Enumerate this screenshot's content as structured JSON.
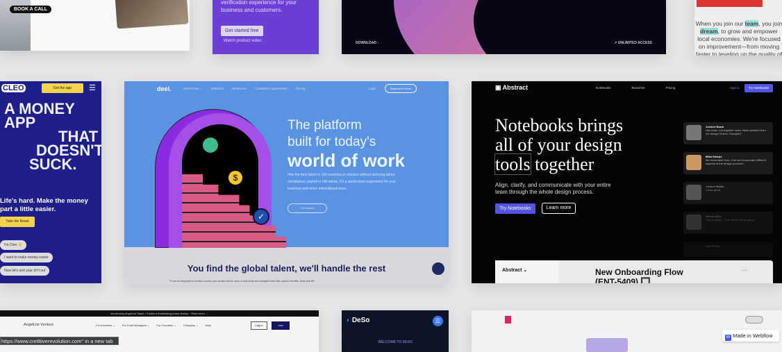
{
  "card1": {
    "book_call": "BOOK A CALL"
  },
  "card2": {
    "text": "verification experience for your business and customers.",
    "cta": "Get started free",
    "watch": "Watch product video"
  },
  "card3": {
    "download": "DOWNLOAD ↓",
    "unlimited": "↗ UNLIMITED ACCESS"
  },
  "card4": {
    "pre": "When you join our ",
    "team": "team",
    "mid": ", you join ",
    "dream": "dream",
    "post": ", to grow and empower local economies. We're focused on improvement—from moving faster to leveling up the quality of our prod"
  },
  "cleo": {
    "logo": "CLEO",
    "get_app": "Get the app",
    "headline1": "A MONEY",
    "headline2": "APP",
    "headline3": "THAT",
    "headline4": "DOESN'T",
    "headline5": "SUCK.",
    "sub": "Life's hard. Make the money part a little easier.",
    "cta": "Take the Roast",
    "chat": [
      "I'm Cleo 👋",
      "I want to make money easier",
      "Now let's sort your sh*t out"
    ]
  },
  "deel": {
    "logo": "deel.",
    "nav": [
      "Here's how ⌄",
      "Solutions",
      "Resources",
      "Contractor Agreements",
      "Pricing"
    ],
    "login": "Login",
    "demo": "Request a Demo",
    "h1": "The platform",
    "h2": "built for today's",
    "h3": "world of work",
    "body": "Hire the best talent in 150 countries in minutes without worrying about compliance, payroll or HR admin. It's a world-class experience for your business and never international team.",
    "cta": "Get started",
    "section_title": "You find the global talent, we'll handle the rest",
    "section_body": "To hire an employee in another country, you usually need to open a local entity and navigate those files: payroll, benefits, taxes and HR"
  },
  "abstract": {
    "logo": "Abstract",
    "nav": [
      "Notebooks",
      "Branches",
      "Pricing"
    ],
    "signin": "Sign in",
    "try_nav": "Try Notebooks",
    "h1": "Notebooks brings",
    "h2": "all of your design",
    "h3a": "tools",
    "h3b": "together",
    "sub": "Align, clarify, and communicate with your entire team through the whole design process.",
    "try": "Try Notebooks",
    "learn": "Learn more",
    "comments": [
      {
        "name": "Joebert Bazár",
        "text": "Hey team, put together some ideas sparked from our design review. Thoughts?"
      },
      {
        "name": "Mika Sharpe",
        "text": "the movement here. Can we incorporate different aspects of the design process?"
      },
      {
        "name": "Joebert Bazár",
        "text": "Looks great"
      },
      {
        "name": "Donna Wolf",
        "text": "This is great — love where this is going"
      },
      {
        "name": "Joel Fisher",
        "text": ""
      }
    ],
    "panel_logo": "Abstract ⌄",
    "panel_title": "New Onboarding Flow",
    "panel_title2": "(ENT-5409) 🔲"
  },
  "angellist": {
    "banner": "Introducing AngelList Stack • Create a fundraising-ready startup · Read more →",
    "logo": "AngelList Venture",
    "nav": [
      "For Investors ⌄",
      "For Fund Managers ⌄",
      "For Founders ⌄",
      "Company ⌄",
      "Help"
    ],
    "login": "Log in",
    "join": "Join"
  },
  "deso": {
    "logo": "DeSo",
    "welcome": "WELCOME TO DESO"
  },
  "status_bar": "https://www.cre8tiverevolution.com\" in a new tab",
  "webflow": "Made in Webflow",
  "colors": {
    "cleo": "#1f1f8c",
    "deel": "#5a93e2",
    "purple": "#6b3fd6",
    "abstract_accent": "#5256e0"
  }
}
